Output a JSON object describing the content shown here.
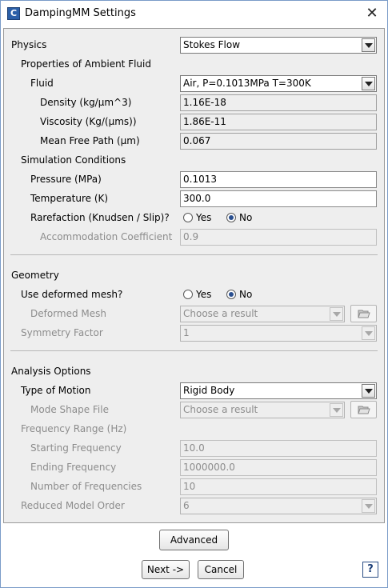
{
  "window": {
    "title": "DampingMM Settings"
  },
  "physics": {
    "label": "Physics",
    "value": "Stokes Flow"
  },
  "ambient": {
    "heading": "Properties of Ambient Fluid",
    "fluid": {
      "label": "Fluid",
      "value": "Air, P=0.1013MPa T=300K"
    },
    "density": {
      "label": "Density (kg/µm^3)",
      "value": "1.16E-18"
    },
    "viscosity": {
      "label": "Viscosity (Kg/(µms))",
      "value": "1.86E-11"
    },
    "mean_free_path": {
      "label": "Mean Free Path (µm)",
      "value": "0.067"
    }
  },
  "simulation": {
    "heading": "Simulation Conditions",
    "pressure": {
      "label": "Pressure (MPa)",
      "value": "0.1013"
    },
    "temperature": {
      "label": "Temperature (K)",
      "value": "300.0"
    },
    "rarefaction": {
      "label": "Rarefaction (Knudsen / Slip)?",
      "yes": "Yes",
      "no": "No",
      "selected": "No"
    },
    "accommodation": {
      "label": "Accommodation Coefficient",
      "value": "0.9"
    }
  },
  "geometry": {
    "heading": "Geometry",
    "deformed": {
      "label": "Use deformed mesh?",
      "yes": "Yes",
      "no": "No",
      "selected": "No"
    },
    "deformed_mesh": {
      "label": "Deformed Mesh",
      "value": "Choose a result"
    },
    "symmetry": {
      "label": "Symmetry Factor",
      "value": "1"
    }
  },
  "analysis": {
    "heading": "Analysis Options",
    "motion": {
      "label": "Type of Motion",
      "value": "Rigid Body"
    },
    "mode_shape": {
      "label": "Mode Shape File",
      "value": "Choose a result"
    },
    "freq_heading": "Frequency Range (Hz)",
    "start_freq": {
      "label": "Starting Frequency",
      "value": "10.0"
    },
    "end_freq": {
      "label": "Ending Frequency",
      "value": "1000000.0"
    },
    "num_freq": {
      "label": "Number of Frequencies",
      "value": "10"
    },
    "reduced_order": {
      "label": "Reduced Model Order",
      "value": "6"
    }
  },
  "buttons": {
    "advanced": "Advanced",
    "next": "Next ->",
    "cancel": "Cancel"
  },
  "icons": {
    "app": "app-logo-icon",
    "close": "close-icon",
    "folder": "open-folder-icon",
    "help": "help-icon"
  }
}
